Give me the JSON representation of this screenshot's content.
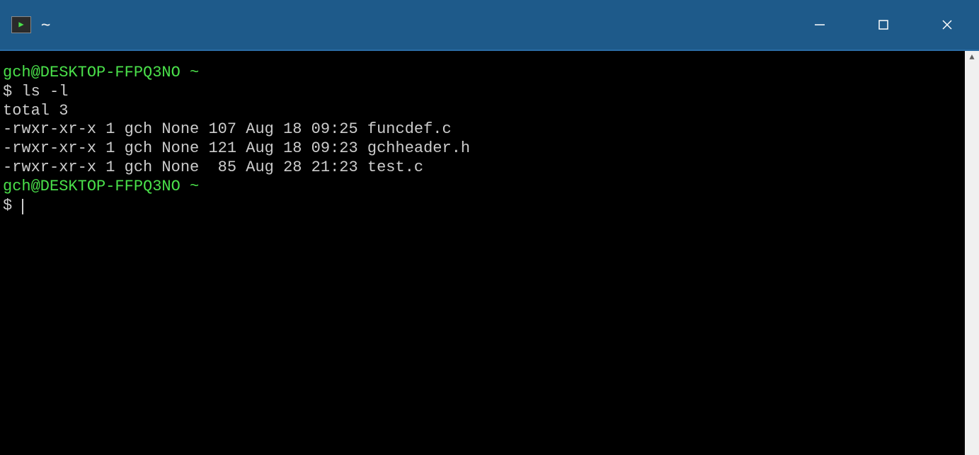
{
  "window": {
    "title": "~"
  },
  "terminal": {
    "prompt1": {
      "user_host": "gch@DESKTOP-FFPQ3NO",
      "path": "~",
      "dollar": "$",
      "command": "ls -l"
    },
    "output": {
      "total_line": "total 3",
      "entries": [
        {
          "perms": "-rwxr-xr-x",
          "links": "1",
          "owner": "gch",
          "group": "None",
          "size": "107",
          "month": "Aug",
          "day": "18",
          "time": "09:25",
          "name": "funcdef.c"
        },
        {
          "perms": "-rwxr-xr-x",
          "links": "1",
          "owner": "gch",
          "group": "None",
          "size": "121",
          "month": "Aug",
          "day": "18",
          "time": "09:23",
          "name": "gchheader.h"
        },
        {
          "perms": "-rwxr-xr-x",
          "links": "1",
          "owner": "gch",
          "group": "None",
          "size": " 85",
          "month": "Aug",
          "day": "28",
          "time": "21:23",
          "name": "test.c"
        }
      ]
    },
    "prompt2": {
      "user_host": "gch@DESKTOP-FFPQ3NO",
      "path": "~",
      "dollar": "$"
    }
  }
}
